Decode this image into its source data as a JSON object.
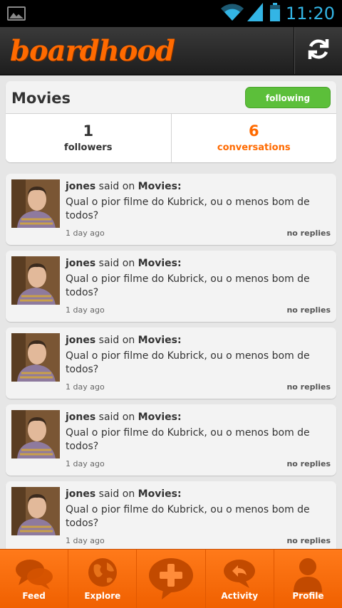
{
  "status_bar": {
    "time": "11:20",
    "icons": [
      "image-icon",
      "wifi-icon",
      "signal-icon",
      "battery-icon"
    ]
  },
  "app_bar": {
    "logo_text": "boardhood",
    "refresh_icon": "refresh-icon"
  },
  "board": {
    "title": "Movies",
    "follow_label": "following",
    "stats": [
      {
        "value": "1",
        "label": "followers"
      },
      {
        "value": "6",
        "label": "conversations"
      }
    ]
  },
  "conversations": [
    {
      "user": "jones",
      "said_on": "said on",
      "board": "Movies:",
      "message": "Qual o pior filme do Kubrick, ou o menos bom de todos?",
      "time": "1 day ago",
      "replies": "no replies"
    },
    {
      "user": "jones",
      "said_on": "said on",
      "board": "Movies:",
      "message": "Qual o pior filme do Kubrick, ou o menos bom de todos?",
      "time": "1 day ago",
      "replies": "no replies"
    },
    {
      "user": "jones",
      "said_on": "said on",
      "board": "Movies:",
      "message": "Qual o pior filme do Kubrick, ou o menos bom de todos?",
      "time": "1 day ago",
      "replies": "no replies"
    },
    {
      "user": "jones",
      "said_on": "said on",
      "board": "Movies:",
      "message": "Qual o pior filme do Kubrick, ou o menos bom de todos?",
      "time": "1 day ago",
      "replies": "no replies"
    },
    {
      "user": "jones",
      "said_on": "said on",
      "board": "Movies:",
      "message": "Qual o pior filme do Kubrick, ou o menos bom de todos?",
      "time": "1 day ago",
      "replies": "no replies"
    }
  ],
  "tabs": [
    {
      "label": "Feed",
      "icon": "chat-bubbles-icon"
    },
    {
      "label": "Explore",
      "icon": "globe-icon"
    },
    {
      "label": "",
      "icon": "add-bubble-icon"
    },
    {
      "label": "Activity",
      "icon": "reply-bubble-icon"
    },
    {
      "label": "Profile",
      "icon": "person-icon"
    }
  ],
  "colors": {
    "accent": "#ff6a00",
    "follow_green": "#5cbf3a",
    "clock_blue": "#33b5e5"
  }
}
